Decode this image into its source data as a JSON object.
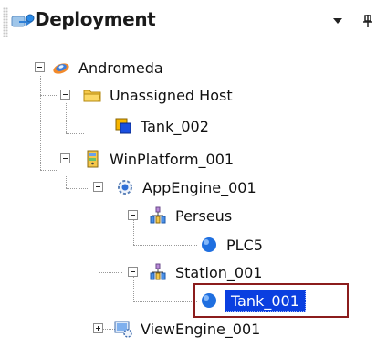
{
  "header": {
    "title": "Deployment",
    "dropdown_icon": "dropdown-arrow-icon",
    "pin_icon": "pin-icon"
  },
  "tree": {
    "root": {
      "label": "Andromeda",
      "icon": "galaxy-icon",
      "expanded": true
    },
    "unassigned_host": {
      "label": "Unassigned Host",
      "icon": "folder-icon",
      "expanded": true
    },
    "tank_002": {
      "label": "Tank_002",
      "icon": "object-icon"
    },
    "winplatform": {
      "label": "WinPlatform_001",
      "icon": "platform-icon",
      "expanded": true
    },
    "appengine": {
      "label": "AppEngine_001",
      "icon": "engine-gear-icon",
      "expanded": true
    },
    "perseus": {
      "label": "Perseus",
      "icon": "area-icon",
      "expanded": true
    },
    "plc5": {
      "label": "PLC5",
      "icon": "blue-sphere-icon"
    },
    "station": {
      "label": "Station_001",
      "icon": "area-icon",
      "expanded": true
    },
    "tank_001": {
      "label": "Tank_001",
      "icon": "blue-sphere-icon",
      "selected": true
    },
    "viewengine": {
      "label": "ViewEngine_001",
      "icon": "view-engine-icon",
      "expanded": false
    }
  },
  "colors": {
    "selection_bg": "#0a3fe0",
    "highlight_border": "#8b1c1c",
    "tree_line": "#9a9a9a"
  }
}
